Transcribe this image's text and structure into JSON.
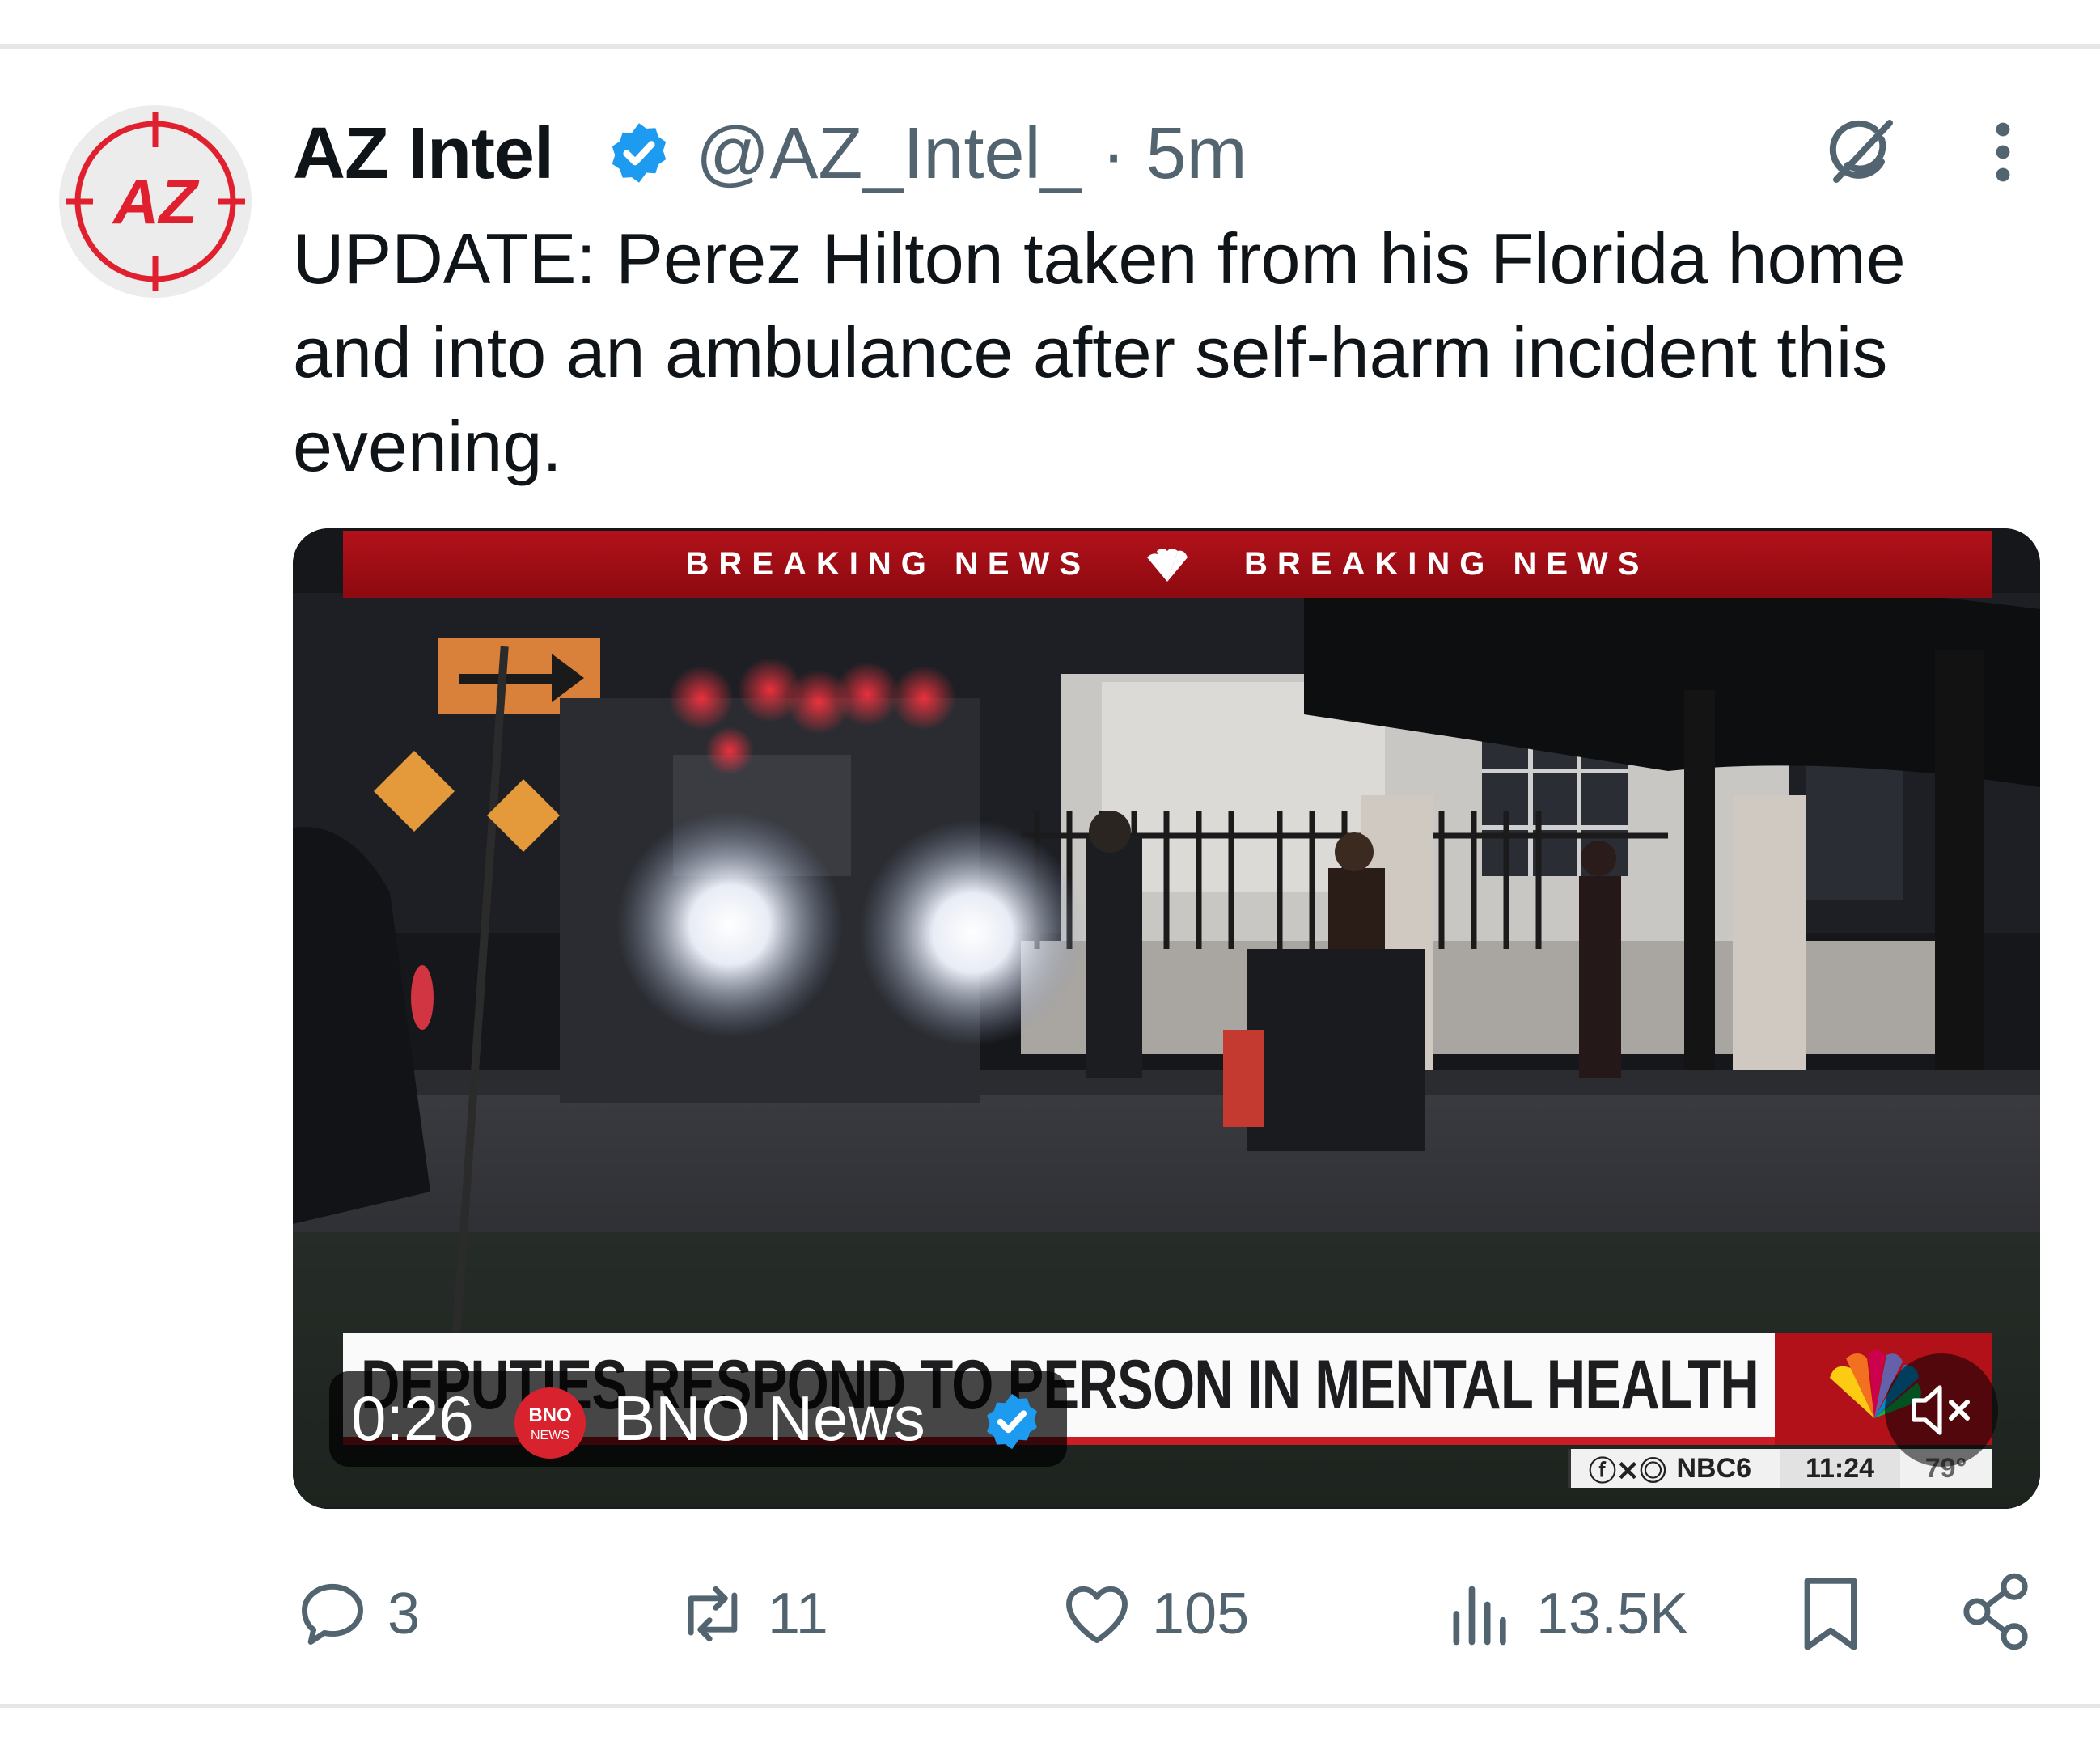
{
  "tweet": {
    "author_name": "AZ Intel",
    "handle_time": "@AZ_Intel_ · 5m",
    "avatar_text": "AZ",
    "text": "UPDATE: Perez Hilton taken from his Florida home and into an ambulance after self-harm incident this evening.",
    "icons": [
      "verified-badge-icon",
      "grok-icon",
      "more-options-icon"
    ]
  },
  "media": {
    "banner_left": "BREAKING NEWS",
    "banner_right": "BREAKING NEWS",
    "headline": "DEPUTIES RESPOND TO PERSON IN MENTAL HEALTH CRISIS",
    "ticker_social": "NBC6",
    "ticker_time": "11:24",
    "ticker_temp": "79°",
    "duration": "0:26",
    "source_logo_text": "BNO NEWS",
    "source_name": "BNO News",
    "colors": {
      "banner_red": "#b3111a",
      "verified_blue": "#1d9bf0"
    }
  },
  "actions": {
    "replies": "3",
    "reposts": "11",
    "likes": "105",
    "views": "13.5K"
  }
}
